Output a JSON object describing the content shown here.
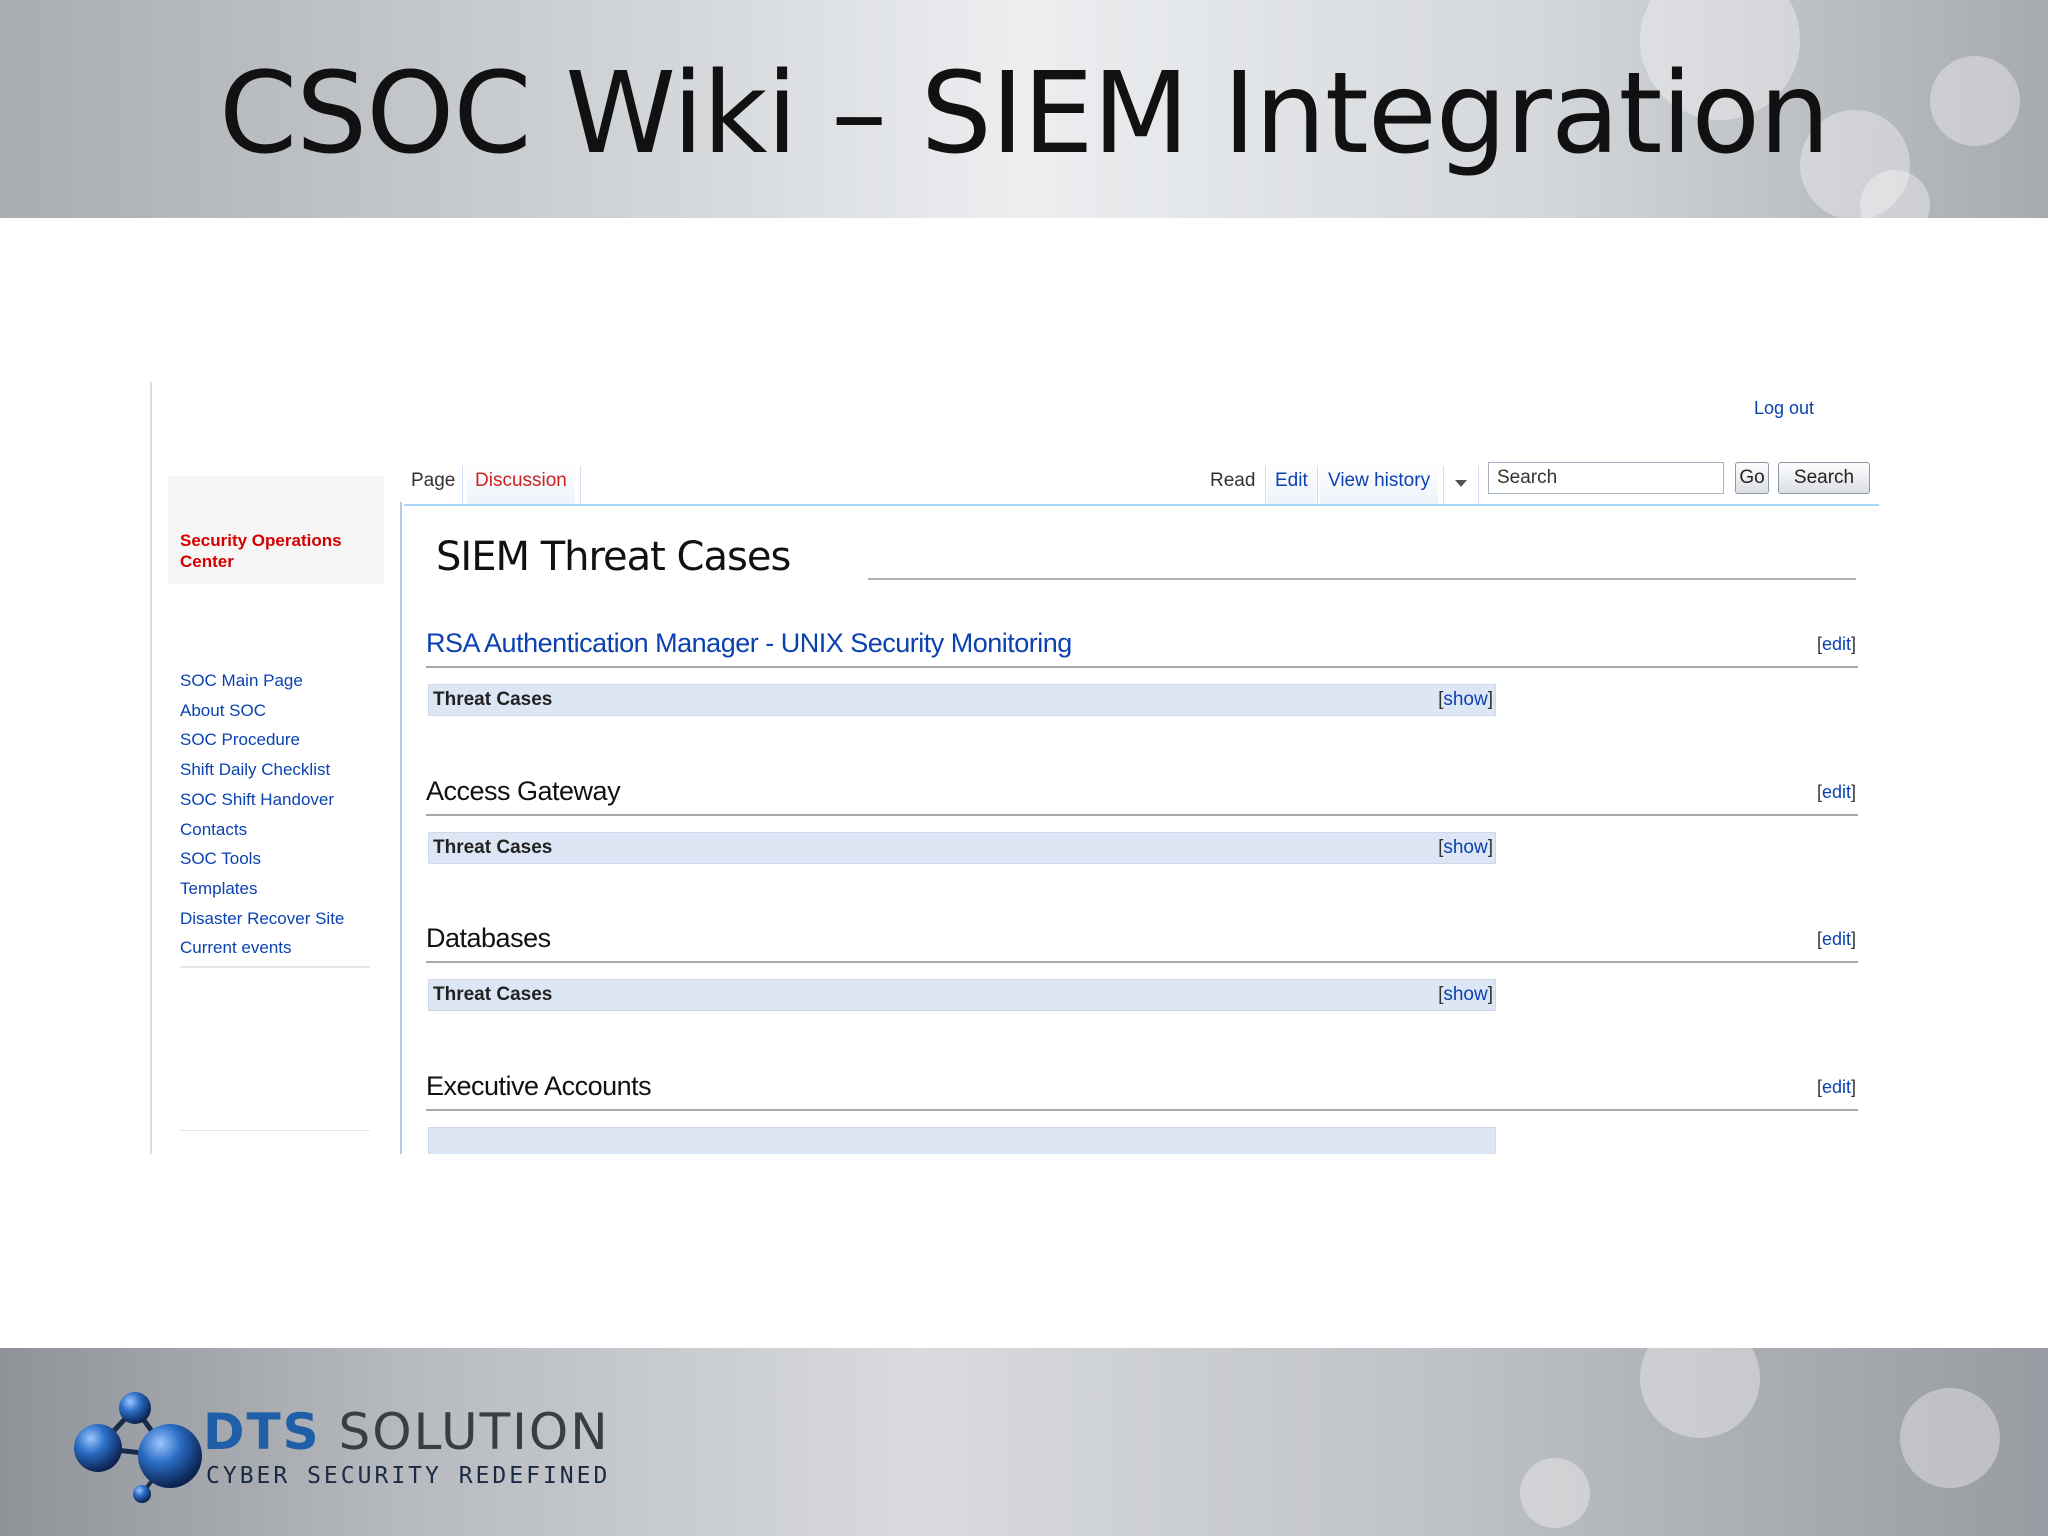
{
  "slide": {
    "title": "CSOC Wiki – SIEM Integration",
    "footer_logo": {
      "name_part1": "DTS",
      "name_part2": "SOLUTION",
      "tagline": "CYBER SECURITY REDEFINED",
      "icon": "molecule-logo-icon"
    }
  },
  "wiki": {
    "logout_label": "Log out",
    "site_name": "Security Operations Center",
    "nav_items": [
      "SOC Main Page",
      "About SOC",
      "SOC Procedure",
      "Shift Daily Checklist",
      "SOC Shift Handover",
      "Contacts",
      "SOC Tools",
      "Templates",
      "Disaster Recover Site",
      "Current events"
    ],
    "tabs": {
      "page": "Page",
      "discussion": "Discussion",
      "read": "Read",
      "edit": "Edit",
      "view_history": "View history"
    },
    "search": {
      "value": "Search",
      "go_label": "Go",
      "search_label": "Search"
    },
    "page_title": "SIEM Threat Cases",
    "edit_bracket_open": "[",
    "edit_label": "edit",
    "edit_bracket_close": "]",
    "show_label": "show",
    "sections": [
      {
        "title": "RSA Authentication Manager - UNIX Security Monitoring",
        "threat_label": "Threat Cases"
      },
      {
        "title": "Access Gateway",
        "threat_label": "Threat Cases"
      },
      {
        "title": "Databases",
        "threat_label": "Threat Cases"
      },
      {
        "title": "Executive Accounts",
        "threat_label": ""
      }
    ],
    "colors": {
      "link": "#0b42b0",
      "site_name": "#d40000",
      "threat_bar": "#dde6f5"
    }
  }
}
